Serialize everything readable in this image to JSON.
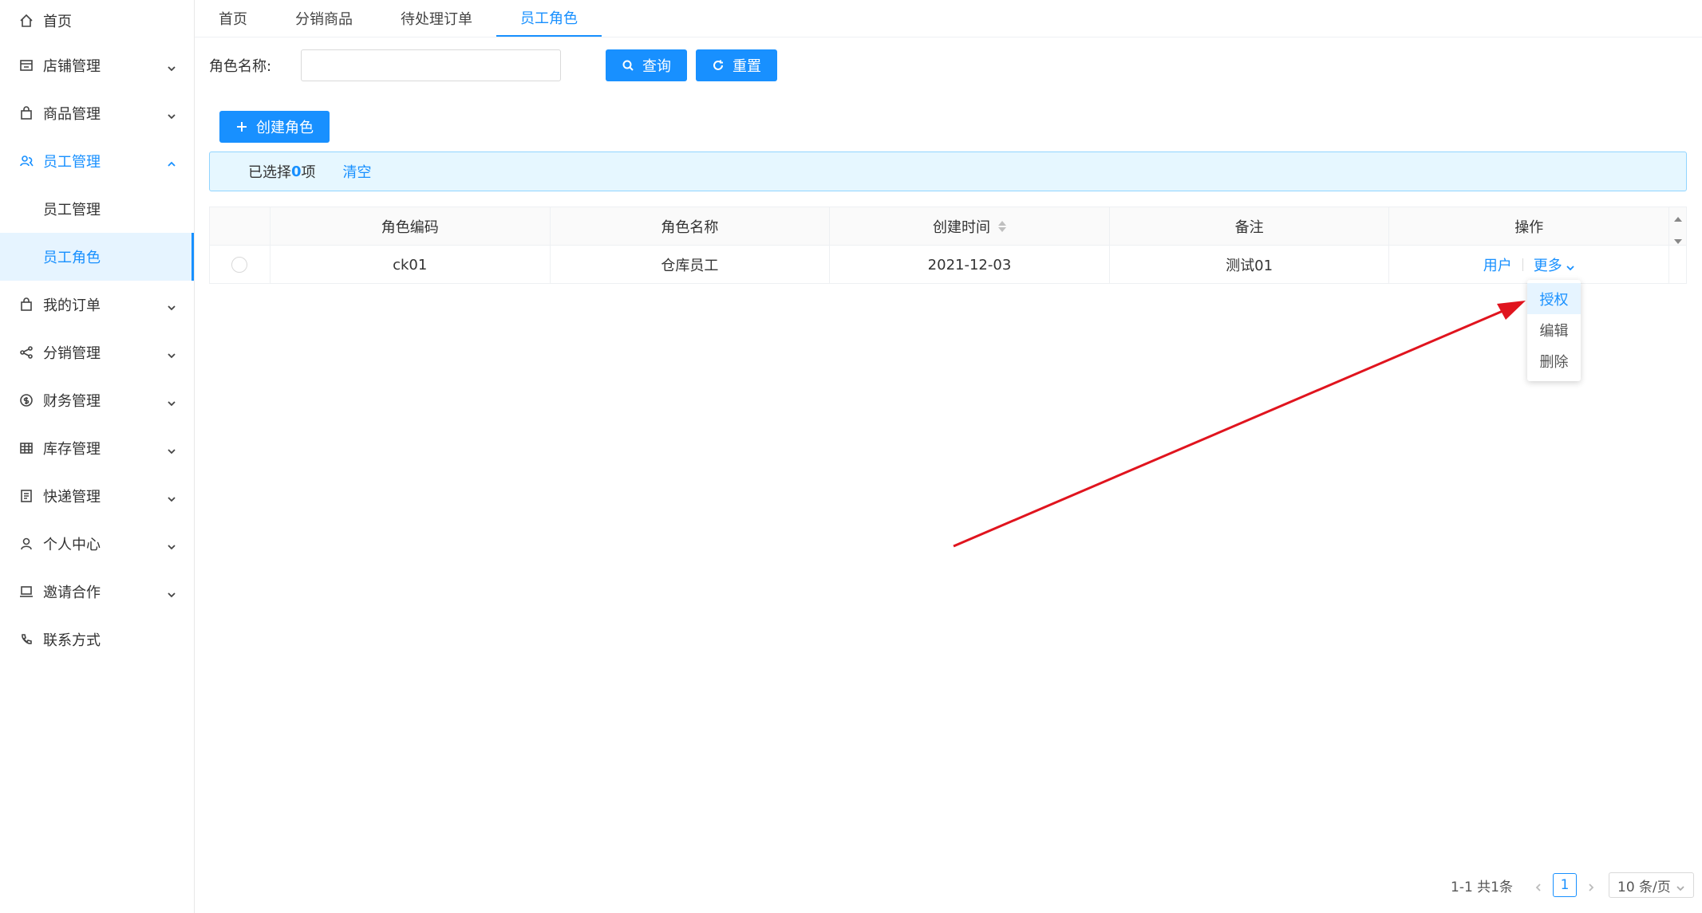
{
  "sidebar": {
    "items": [
      {
        "label": "首页",
        "icon": "home-icon"
      },
      {
        "label": "店铺管理",
        "icon": "store-icon"
      },
      {
        "label": "商品管理",
        "icon": "bag-icon"
      },
      {
        "label": "员工管理",
        "icon": "staff-icon"
      },
      {
        "label": "我的订单",
        "icon": "order-icon"
      },
      {
        "label": "分销管理",
        "icon": "share-icon"
      },
      {
        "label": "财务管理",
        "icon": "dollar-icon"
      },
      {
        "label": "库存管理",
        "icon": "table-icon"
      },
      {
        "label": "快递管理",
        "icon": "list-icon"
      },
      {
        "label": "个人中心",
        "icon": "user-icon"
      },
      {
        "label": "邀请合作",
        "icon": "laptop-icon"
      },
      {
        "label": "联系方式",
        "icon": "phone-icon"
      }
    ],
    "submenu": [
      {
        "label": "员工管理"
      },
      {
        "label": "员工角色"
      }
    ]
  },
  "tabs": [
    {
      "label": "首页"
    },
    {
      "label": "分销商品"
    },
    {
      "label": "待处理订单"
    },
    {
      "label": "员工角色"
    }
  ],
  "search": {
    "label": "角色名称:",
    "value": "",
    "search_button": "查询",
    "reset_button": "重置"
  },
  "create_button": "创建角色",
  "alert": {
    "prefix": "已选择",
    "count": "0",
    "suffix": "项",
    "clear": "清空"
  },
  "table": {
    "columns": [
      "角色编码",
      "角色名称",
      "创建时间",
      "备注",
      "操作"
    ],
    "rows": [
      {
        "code": "ck01",
        "name": "仓库员工",
        "created": "2021-12-03",
        "remark": "测试01",
        "op_users": "用户",
        "op_more": "更多"
      }
    ]
  },
  "dropdown": [
    "授权",
    "编辑",
    "删除"
  ],
  "pagination": {
    "total": "1-1 共1条",
    "current": "1",
    "page_size": "10 条/页"
  },
  "colors": {
    "primary": "#1890ff",
    "alert_bg": "#e6f7ff",
    "arrow": "#e0141e"
  }
}
